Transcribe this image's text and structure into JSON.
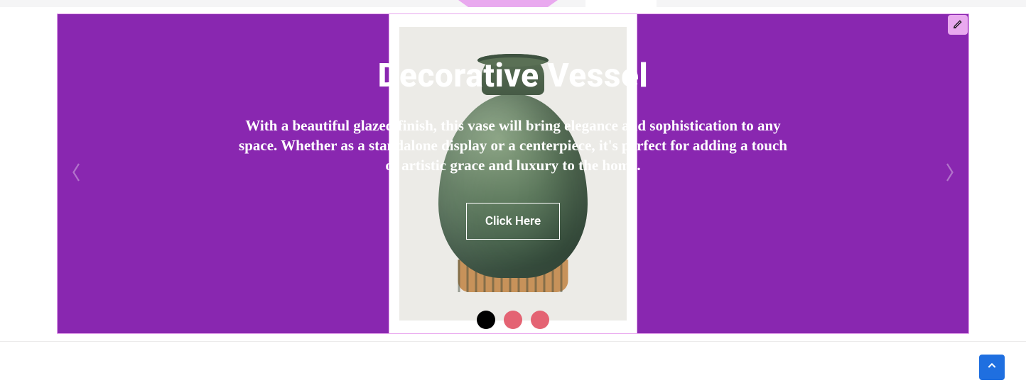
{
  "colors": {
    "slider_bg": "#8927b0",
    "accent_pink": "#e9a9ef",
    "dot_inactive": "#e46373",
    "dot_active": "#000000",
    "scroll_top": "#1f6fe0"
  },
  "slider": {
    "title": "Decorative Vessel",
    "description": "With a beautiful glazed finish, this vase will bring elegance and sophistication to any space. Whether as a standalone display or a centerpiece, it's perfect for adding a touch of artistic grace and luxury to the home.",
    "button_label": "Click Here",
    "active_dot_index": 0,
    "dot_count": 3
  },
  "icons": {
    "edit": "pencil-icon",
    "prev": "chevron-left-icon",
    "next": "chevron-right-icon",
    "scroll_top": "chevron-up-icon"
  }
}
